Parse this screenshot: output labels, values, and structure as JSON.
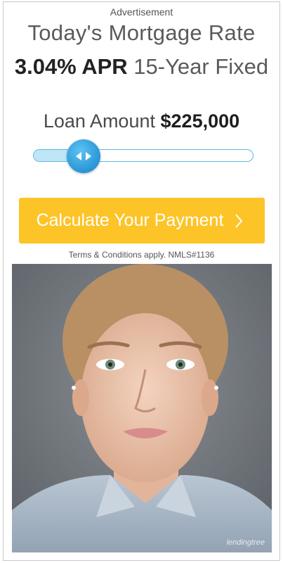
{
  "ad": {
    "label": "Advertisement",
    "title": "Today's Mortgage Rate",
    "rate_value": "3.04% APR",
    "rate_term": "15-Year Fixed",
    "loan_label": "Loan Amount",
    "loan_amount": "$225,000",
    "slider_fraction": 0.23,
    "cta_label": "Calculate Your Payment",
    "terms": "Terms & Conditions apply. NMLS#1136",
    "watermark": "lendingtree"
  },
  "colors": {
    "cta": "#fdc427",
    "slider_handle": "#2a95d6",
    "slider_fill": "#bfe6f7",
    "slider_border": "#5bb8e0"
  },
  "icons": {
    "slider_handle": "left-right-arrows-icon",
    "cta": "chevron-right-icon"
  }
}
